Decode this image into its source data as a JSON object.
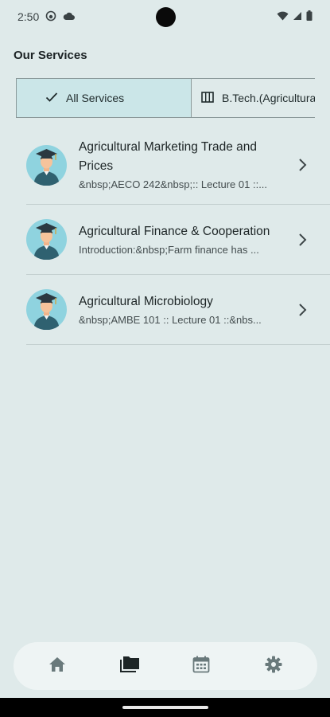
{
  "status_bar": {
    "time": "2:50"
  },
  "page": {
    "title": "Our Services"
  },
  "filters": {
    "items": [
      {
        "label": "All Services",
        "selected": true
      },
      {
        "label": "B.Tech.(Agricultural",
        "selected": false
      }
    ]
  },
  "services": [
    {
      "title": "Agricultural Marketing Trade and Prices",
      "subtitle": "&nbsp;AECO 242&nbsp;:: Lecture 01 ::..."
    },
    {
      "title": "Agricultural Finance & Cooperation",
      "subtitle": "Introduction:&nbsp;Farm finance has ..."
    },
    {
      "title": "Agricultural Microbiology",
      "subtitle": "&nbsp;AMBE 101 :: Lecture 01 ::&nbs..."
    }
  ],
  "bottom_nav": {
    "items": [
      {
        "icon": "home-icon",
        "active": false
      },
      {
        "icon": "folders-icon",
        "active": true
      },
      {
        "icon": "calendar-icon",
        "active": false
      },
      {
        "icon": "settings-icon",
        "active": false
      }
    ]
  },
  "colors": {
    "background": "#dfeaea",
    "selected_chip": "#cbe6e8",
    "nav_bar": "#eef4f4",
    "icon_active": "#1d2526",
    "icon_inactive": "#69797b"
  }
}
